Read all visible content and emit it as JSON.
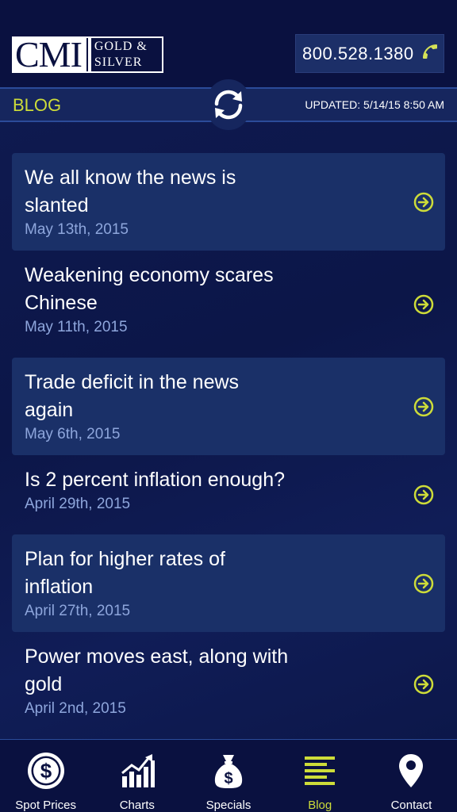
{
  "header": {
    "logo_main": "CMI",
    "logo_line1": "GOLD &",
    "logo_line2": "SILVER",
    "phone": "800.528.1380",
    "section_title": "BLOG",
    "updated": "UPDATED: 5/14/15 8:50 AM"
  },
  "posts": [
    {
      "title_line1": "We all know the news is",
      "title_line2": "slanted",
      "date": "May 13th, 2015"
    },
    {
      "title_line1": "Weakening economy scares",
      "title_line2": "Chinese",
      "date": "May 11th, 2015"
    },
    {
      "title_line1": "Trade deficit in the news",
      "title_line2": "again",
      "date": "May 6th, 2015"
    },
    {
      "title_line1": "Is 2 percent inflation enough?",
      "title_line2": "",
      "date": "April 29th, 2015"
    },
    {
      "title_line1": "Plan for higher rates of",
      "title_line2": "inflation",
      "date": "April 27th, 2015"
    },
    {
      "title_line1": "Power moves east, along with",
      "title_line2": "gold",
      "date": "April 2nd, 2015"
    }
  ],
  "tabs": [
    {
      "label": "Spot Prices",
      "icon": "dollar-coin-icon"
    },
    {
      "label": "Charts",
      "icon": "bar-chart-icon"
    },
    {
      "label": "Specials",
      "icon": "money-bag-icon"
    },
    {
      "label": "Blog",
      "icon": "list-lines-icon"
    },
    {
      "label": "Contact",
      "icon": "map-pin-icon"
    }
  ],
  "colors": {
    "accent": "#cddc39",
    "background": "#0c1648",
    "card": "#1a3068",
    "date": "#8ea6dc"
  }
}
